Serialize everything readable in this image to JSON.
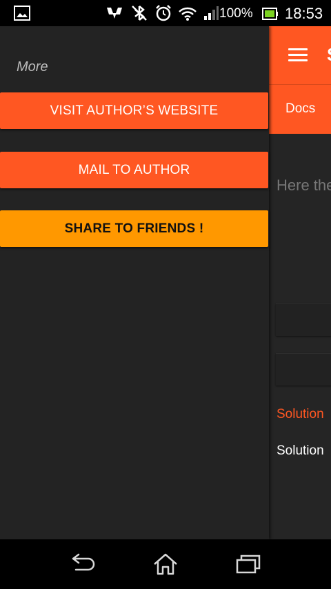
{
  "status_bar": {
    "battery_percent": "100%",
    "time": "18:53",
    "icons": [
      "gallery-icon",
      "nfc-icon",
      "bluetooth-off-icon",
      "alarm-icon",
      "wifi-icon",
      "signal-icon",
      "battery-icon"
    ]
  },
  "drawer": {
    "header": "More",
    "buttons": [
      {
        "label": "VISIT AUTHOR’S WEBSITE",
        "color": "#ff5722"
      },
      {
        "label": "MAIL TO AUTHOR",
        "color": "#ff5722"
      },
      {
        "label": "SHARE TO FRIENDS !",
        "color": "#ff9800"
      }
    ]
  },
  "app": {
    "title_peek": "S",
    "tab_docs": "Docs",
    "hint_text": "Here the",
    "solution_link": "Solution",
    "solution_text": "Solution",
    "accent": "#ff5722"
  },
  "nav_bar": {
    "icons": [
      "back-icon",
      "home-icon",
      "recents-icon"
    ]
  }
}
